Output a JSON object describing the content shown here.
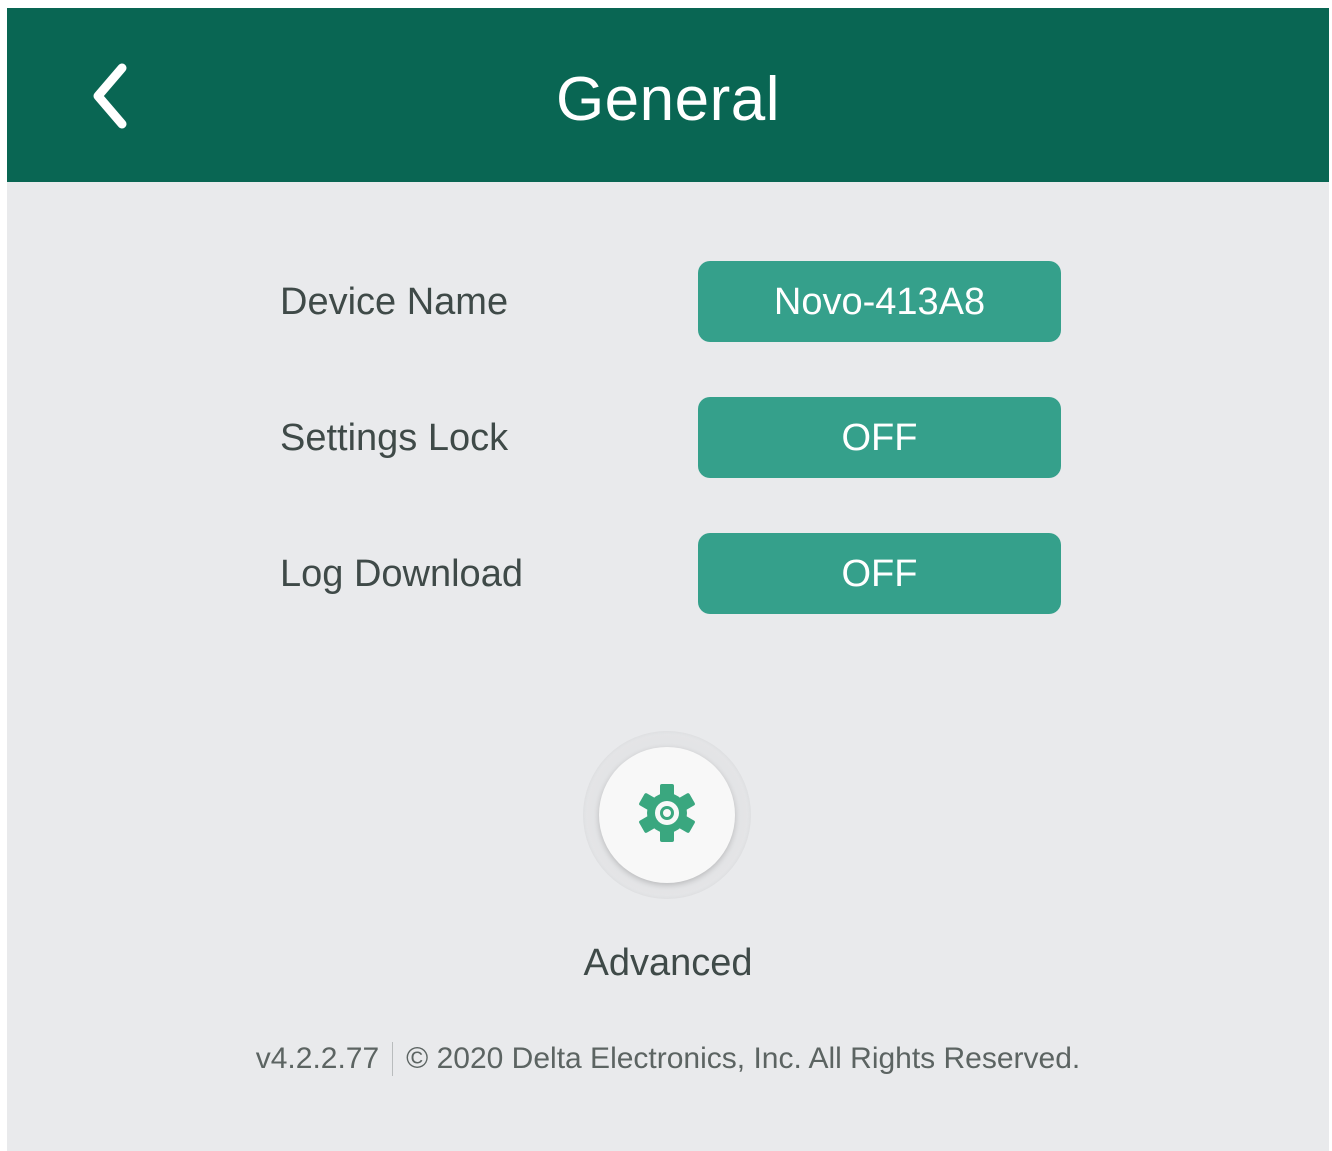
{
  "header": {
    "title": "General",
    "back_icon": "chevron-left-icon"
  },
  "settings": [
    {
      "label": "Device Name",
      "value": "Novo-413A8"
    },
    {
      "label": "Settings Lock",
      "value": "OFF"
    },
    {
      "label": "Log Download",
      "value": "OFF"
    }
  ],
  "advanced": {
    "label": "Advanced",
    "icon": "gear-icon"
  },
  "footer": {
    "version": "v4.2.2.77",
    "copyright": "© 2020 Delta Electronics, Inc. All Rights Reserved."
  },
  "colors": {
    "header_bg": "#096653",
    "button_bg": "#35a08b",
    "page_bg": "#e9eaec",
    "gear": "#3aa77f"
  }
}
